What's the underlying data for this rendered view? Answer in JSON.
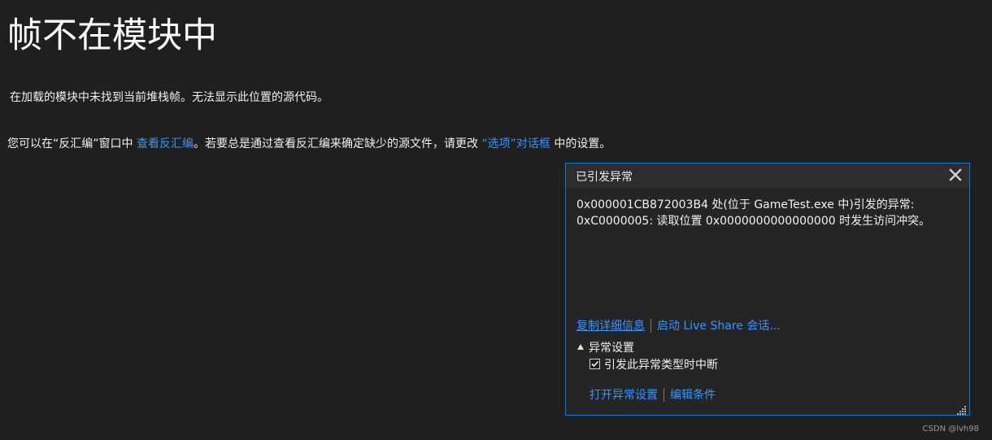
{
  "page": {
    "title": "帧不在模块中",
    "message1": "在加载的模块中未找到当前堆栈帧。无法显示此位置的源代码。",
    "message2_prefix": "您可以在“反汇编”窗口中 ",
    "message2_link1": "查看反汇编",
    "message2_middle": "。若要总是通过查看反汇编来确定缺少的源文件，请更改 ",
    "message2_link2": "“选项”对话框",
    "message2_suffix": " 中的设置。"
  },
  "popup": {
    "title": "已引发异常",
    "close_icon": "close-icon",
    "message_line1": "0x000001CB872003B4 处(位于 GameTest.exe 中)引发的异常:",
    "message_line2": "0xC0000005: 读取位置 0x0000000000000000 时发生访问冲突。",
    "copy_details_link": "复制详细信息",
    "live_share_link": "启动 Live Share 会话...",
    "exception_settings_label": "异常设置",
    "break_checkbox_label": "引发此异常类型时中断",
    "break_checkbox_checked": true,
    "open_settings_link": "打开异常设置",
    "edit_conditions_link": "编辑条件"
  },
  "watermark": "CSDN @lvh98",
  "colors": {
    "background": "#1f1f1f",
    "link": "#3794ff",
    "popup_border": "#007acc",
    "popup_bg": "#252526"
  }
}
